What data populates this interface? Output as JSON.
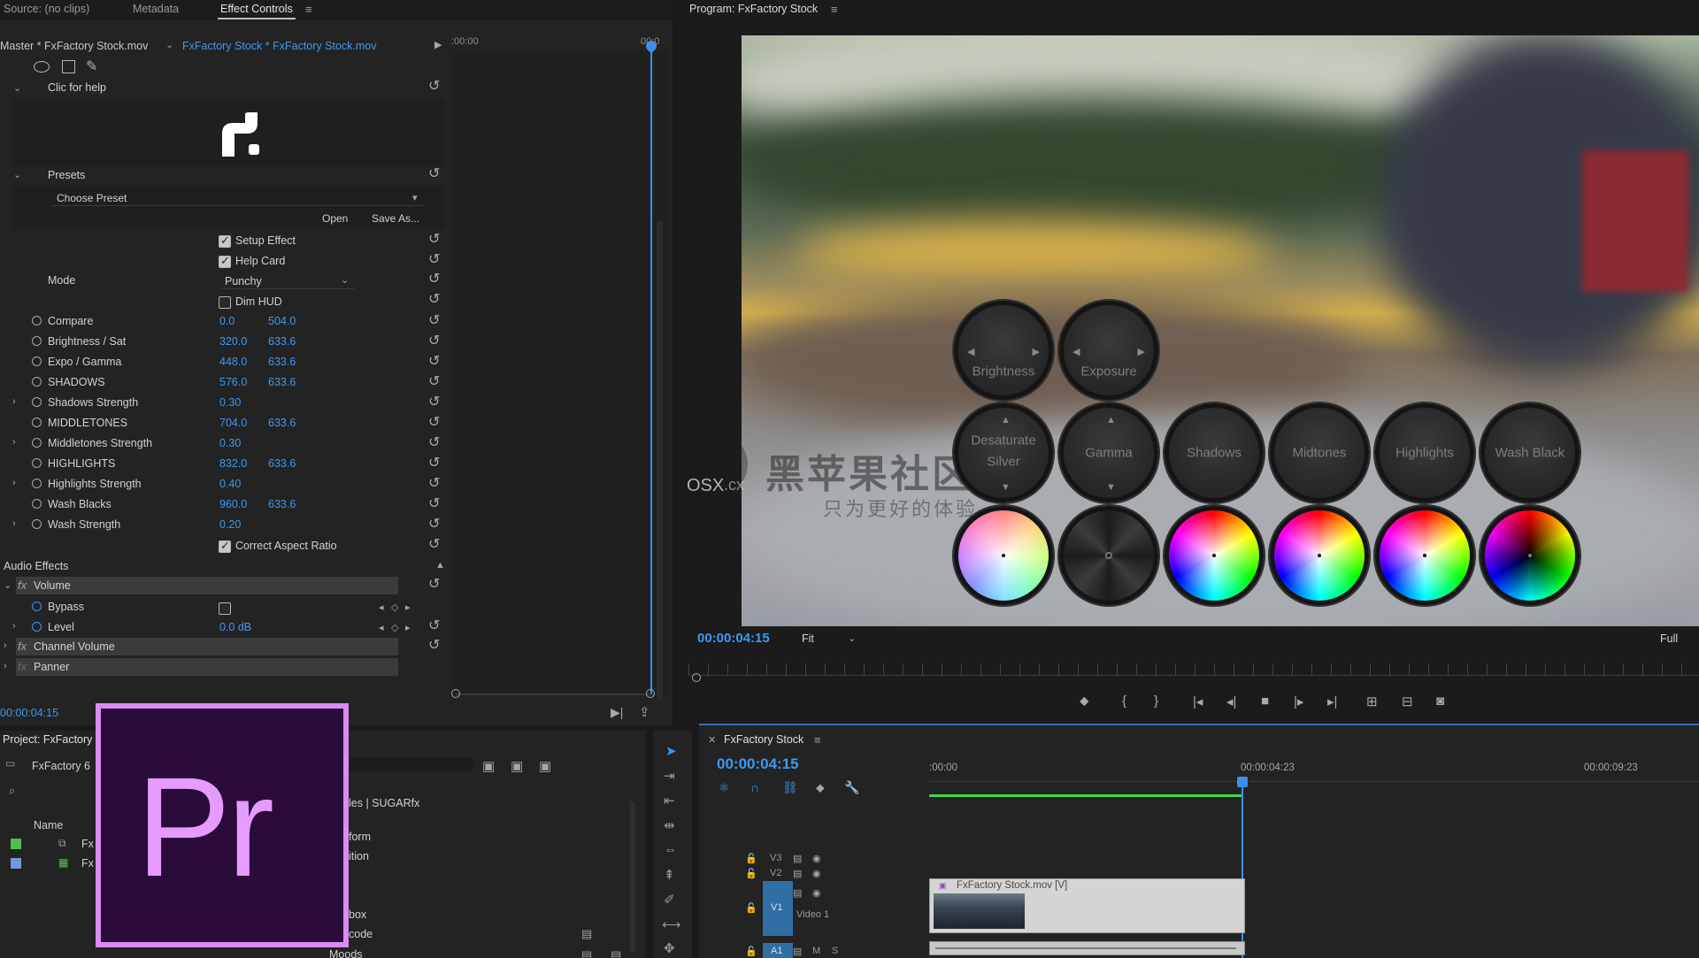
{
  "effect_controls": {
    "tabs": [
      "Source: (no clips)",
      "Metadata",
      "Effect Controls"
    ],
    "master_label": "Master * FxFactory Stock.mov",
    "clip_label": "FxFactory Stock * FxFactory Stock.mov",
    "timeline_start": ":00:00",
    "timeline_end": "00:0",
    "help_label": "Clic for help",
    "presets_label": "Presets",
    "choose_preset": "Choose Preset",
    "open_btn": "Open",
    "save_as_btn": "Save As...",
    "setup_effect": "Setup Effect",
    "help_card": "Help Card",
    "mode_label": "Mode",
    "mode_value": "Punchy",
    "dim_hud": "Dim HUD",
    "params": [
      {
        "label": "Compare",
        "v1": "0.0",
        "v2": "504.0"
      },
      {
        "label": "Brightness / Sat",
        "v1": "320.0",
        "v2": "633.6"
      },
      {
        "label": "Expo / Gamma",
        "v1": "448.0",
        "v2": "633.6"
      },
      {
        "label": "SHADOWS",
        "v1": "576.0",
        "v2": "633.6"
      },
      {
        "label": "Shadows Strength",
        "v1": "0.30",
        "v2": ""
      },
      {
        "label": "MIDDLETONES",
        "v1": "704.0",
        "v2": "633.6"
      },
      {
        "label": "Middletones Strength",
        "v1": "0.30",
        "v2": ""
      },
      {
        "label": "HIGHLIGHTS",
        "v1": "832.0",
        "v2": "633.6"
      },
      {
        "label": "Highlights Strength",
        "v1": "0.40",
        "v2": ""
      },
      {
        "label": "Wash Blacks",
        "v1": "960.0",
        "v2": "633.6"
      },
      {
        "label": "Wash Strength",
        "v1": "0.20",
        "v2": ""
      }
    ],
    "correct_aspect": "Correct Aspect Ratio",
    "audio_effects": "Audio Effects",
    "volume": "Volume",
    "bypass": "Bypass",
    "level": "Level",
    "level_value": "0.0 dB",
    "channel_volume": "Channel Volume",
    "panner": "Panner",
    "current_time": "00:00:04:15",
    "fx_symbol": "fx"
  },
  "program": {
    "title": "Program: FxFactory Stock",
    "timecode": "00:00:04:15",
    "fit": "Fit",
    "full": "Full",
    "hud_knobs_top": [
      "Brightness",
      "Exposure"
    ],
    "hud_knob_saturate": "Desaturate",
    "hud_knob_silver": "Silver",
    "hud_knobs_mid": [
      "Gamma",
      "Shadows",
      "Midtones",
      "Highlights",
      "Wash Black"
    ]
  },
  "watermark": {
    "brand": "黑苹果社区",
    "sub": "只为更好的体验",
    "osx": "OSX",
    "cx": ".cx"
  },
  "project": {
    "title": "Project: FxFactory",
    "item": "FxFactory 6",
    "name_col": "Name",
    "rows": [
      "Fx",
      "Fx"
    ],
    "bins": [
      "les | SUGARfx",
      "form",
      "ition",
      "box",
      "code",
      "Moods"
    ]
  },
  "timeline": {
    "title": "FxFactory Stock",
    "timecode": "00:00:04:15",
    "ruler": [
      ":00:00",
      "00:00:04:23",
      "00:00:09:23"
    ],
    "tracks_v": [
      "V3",
      "V2",
      "V1"
    ],
    "video1": "Video 1",
    "tracks_a": [
      "A1",
      "M",
      "S"
    ],
    "clip": "FxFactory Stock.mov [V]"
  },
  "logo": {
    "text": "Pr"
  },
  "colors": {
    "accent_blue": "#3d99f5",
    "logo_bg": "#2a0b3a",
    "logo_border": "#d98cf2",
    "timeline_green": "#3ed64a"
  }
}
